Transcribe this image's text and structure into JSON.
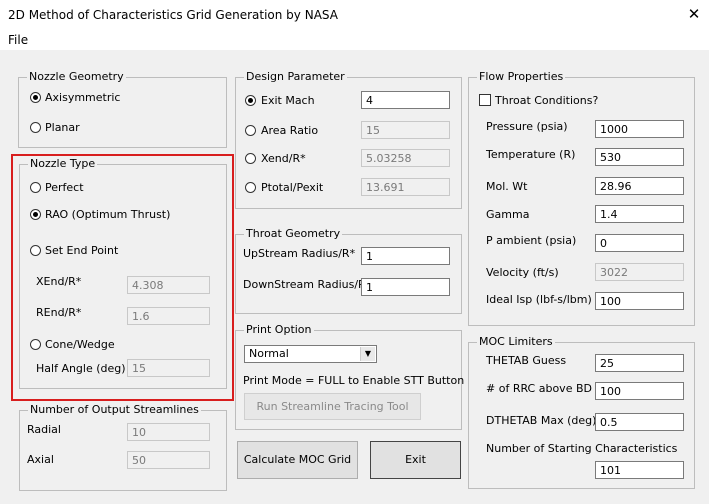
{
  "window": {
    "title": "2D Method of Characteristics Grid Generation by NASA",
    "close_glyph": "✕"
  },
  "menu": {
    "file": "File"
  },
  "nozzle_geometry": {
    "legend": "Nozzle Geometry",
    "axisymmetric": "Axisymmetric",
    "planar": "Planar",
    "selected": "Axisymmetric"
  },
  "nozzle_type": {
    "legend": "Nozzle Type",
    "perfect": "Perfect",
    "rao": "RAO (Optimum Thrust)",
    "set_end_point": "Set End Point",
    "xend_label": "XEnd/R*",
    "xend_value": "4.308",
    "rend_label": "REnd/R*",
    "rend_value": "1.6",
    "cone_wedge": "Cone/Wedge",
    "half_angle_label": "Half Angle (deg)",
    "half_angle_value": "15",
    "selected": "RAO (Optimum Thrust)"
  },
  "output_streamlines": {
    "legend": "Number of Output Streamlines",
    "radial_label": "Radial",
    "radial_value": "10",
    "axial_label": "Axial",
    "axial_value": "50"
  },
  "design_parameter": {
    "legend": "Design Parameter",
    "exit_mach_label": "Exit Mach",
    "exit_mach_value": "4",
    "area_ratio_label": "Area Ratio",
    "area_ratio_value": "15",
    "xend_label": "Xend/R*",
    "xend_value": "5.03258",
    "ptotal_label": "Ptotal/Pexit",
    "ptotal_value": "13.691",
    "selected": "Exit Mach"
  },
  "throat_geometry": {
    "legend": "Throat Geometry",
    "upstream_label": "UpStream Radius/R*",
    "upstream_value": "1",
    "downstream_label": "DownStream Radius/R*",
    "downstream_value": "1"
  },
  "print_option": {
    "legend": "Print Option",
    "mode_value": "Normal",
    "note": "Print Mode = FULL to Enable STT Button",
    "stt_button": "Run Streamline Tracing Tool"
  },
  "buttons": {
    "calculate": "Calculate MOC Grid",
    "exit": "Exit"
  },
  "flow_properties": {
    "legend": "Flow Properties",
    "throat_conditions": "Throat Conditions?",
    "pressure_label": "Pressure (psia)",
    "pressure_value": "1000",
    "temperature_label": "Temperature (R)",
    "temperature_value": "530",
    "molwt_label": "Mol. Wt",
    "molwt_value": "28.96",
    "gamma_label": "Gamma",
    "gamma_value": "1.4",
    "pambient_label": "P ambient (psia)",
    "pambient_value": "0",
    "velocity_label": "Velocity (ft/s)",
    "velocity_value": "3022",
    "isp_label": "Ideal Isp (lbf-s/lbm)",
    "isp_value": "100"
  },
  "moc_limiters": {
    "legend": "MOC Limiters",
    "thetab_label": "THETAB Guess",
    "thetab_value": "25",
    "rrc_label": "# of RRC above BD",
    "rrc_value": "100",
    "dthetab_label": "DTHETAB Max (deg)",
    "dthetab_value": "0.5",
    "starting_label": "Number of Starting Characteristics",
    "starting_value": "101"
  }
}
